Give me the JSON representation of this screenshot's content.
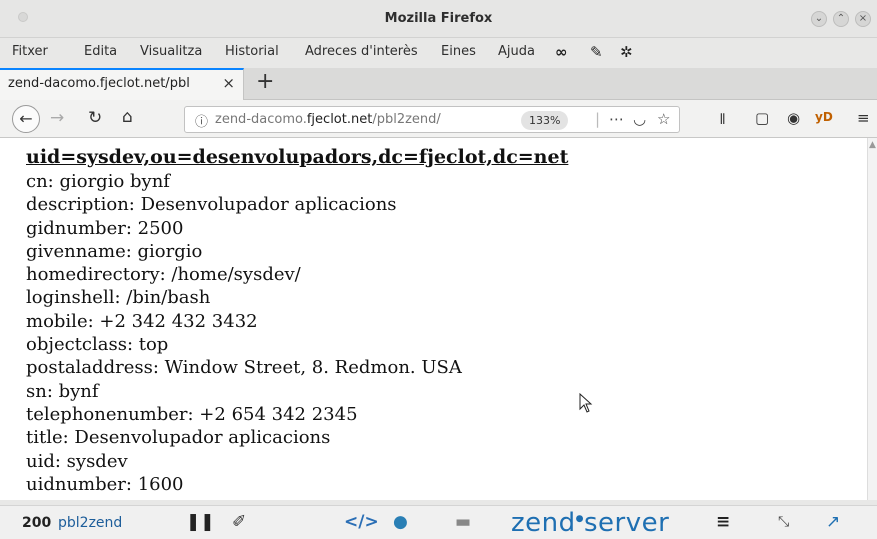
{
  "window": {
    "title": "Mozilla Firefox"
  },
  "menu": {
    "items": [
      "Fitxer",
      "Edita",
      "Visualitza",
      "Historial",
      "Adreces d'interès",
      "Eines",
      "Ajuda"
    ]
  },
  "tab": {
    "title": "zend-dacomo.fjeclot.net/pbl",
    "close": "×",
    "new": "+"
  },
  "address": {
    "url_prefix": "zend-dacomo.",
    "url_domain": "fjeclot.net",
    "url_path": "/pbl2zend/",
    "zoom": "133%"
  },
  "page": {
    "dn": "uid=sysdev,ou=desenvolupadors,dc=fjeclot,dc=net",
    "attributes": [
      "cn: giorgio bynf",
      "description: Desenvolupador aplicacions",
      "gidnumber: 2500",
      "givenname: giorgio",
      "homedirectory: /home/sysdev/",
      "loginshell: /bin/bash",
      "mobile: +2 342 432 3432",
      "objectclass: top",
      "postaladdress: Window Street, 8. Redmon. USA",
      "sn: bynf",
      "telephonenumber: +2 654 342 2345",
      "title: Desenvolupador aplicacions",
      "uid: sysdev",
      "uidnumber: 1600"
    ]
  },
  "zend_toolbar": {
    "status_code": "200",
    "route": "pbl2zend",
    "brand": "zend",
    "brand_suffix": "server"
  },
  "colors": {
    "accent": "#0a84ff",
    "zend_blue": "#1e6fb2"
  }
}
